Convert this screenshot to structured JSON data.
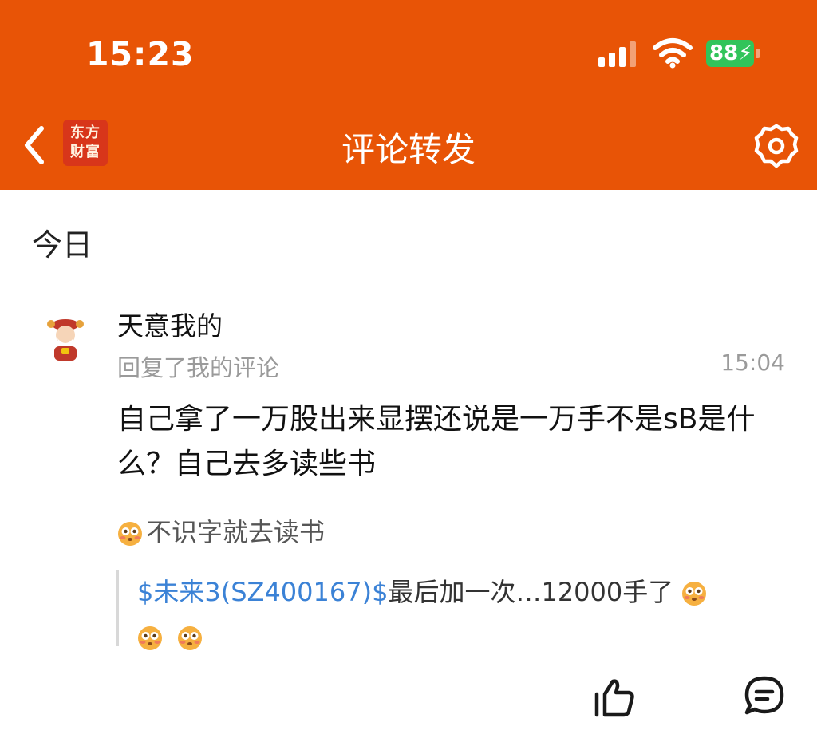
{
  "status_bar": {
    "time": "15:23",
    "battery": "88",
    "battery_color": "#31c45a"
  },
  "nav": {
    "title": "评论转发",
    "logo_line1": "东方",
    "logo_line2": "财富",
    "back_icon": "chevron-left-icon",
    "settings_icon": "gear-icon",
    "bar_color": "#e85406"
  },
  "section": {
    "title": "今日"
  },
  "notification": {
    "username": "天意我的",
    "action": "回复了我的评论",
    "time": "15:04",
    "reply_text": "自己拿了一万股出来显摆还说是一万手不是sB是什么？自己去多读些书",
    "original_comment": "不识字就去读书",
    "quoted_stock": "$未来3(SZ400167)$",
    "quoted_text": "最后加一次…12000手了",
    "link_color": "#3b82d6"
  },
  "actions": {
    "like_icon": "thumbs-up-icon",
    "comment_icon": "comment-bubble-icon"
  }
}
